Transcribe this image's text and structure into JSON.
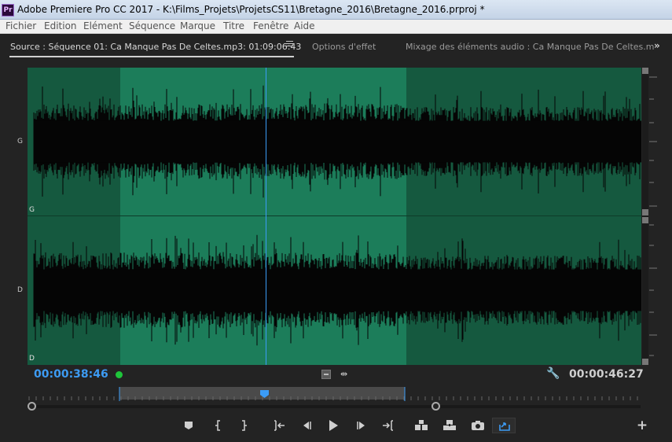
{
  "window": {
    "app_icon_text": "Pr",
    "title": "Adobe Premiere Pro CC 2017 - K:\\Films_Projets\\ProjetsCS11\\Bretagne_2016\\Bretagne_2016.prproj *"
  },
  "menu": [
    "Fichier",
    "Edition",
    "Elément",
    "Séquence",
    "Marque",
    "Titre",
    "Fenêtre",
    "Aide"
  ],
  "tabs": {
    "source": "Source : Séquence 01: Ca Manque Pas De Celtes.mp3: 01:09:06:43",
    "effect_options": "Options d'effet",
    "audio_mixer": "Mixage des éléments audio : Ca Manque Pas De Celtes.m"
  },
  "channels": {
    "left": "G",
    "right": "D"
  },
  "timecode": {
    "current": "00:00:38:46",
    "duration": "00:00:46:27"
  },
  "transport": {
    "buttons": [
      "add-marker",
      "mark-in",
      "mark-out",
      "go-to-in",
      "step-back",
      "play",
      "step-forward",
      "go-to-out",
      "insert",
      "overwrite",
      "export-frame",
      "button-editor"
    ],
    "add_label": "+"
  },
  "colors": {
    "wave_bg": "#1a6d4f",
    "wave_inrange": "#1c7d5a",
    "playhead": "#3b9cf7",
    "timecode_current": "#3d9bf3"
  }
}
